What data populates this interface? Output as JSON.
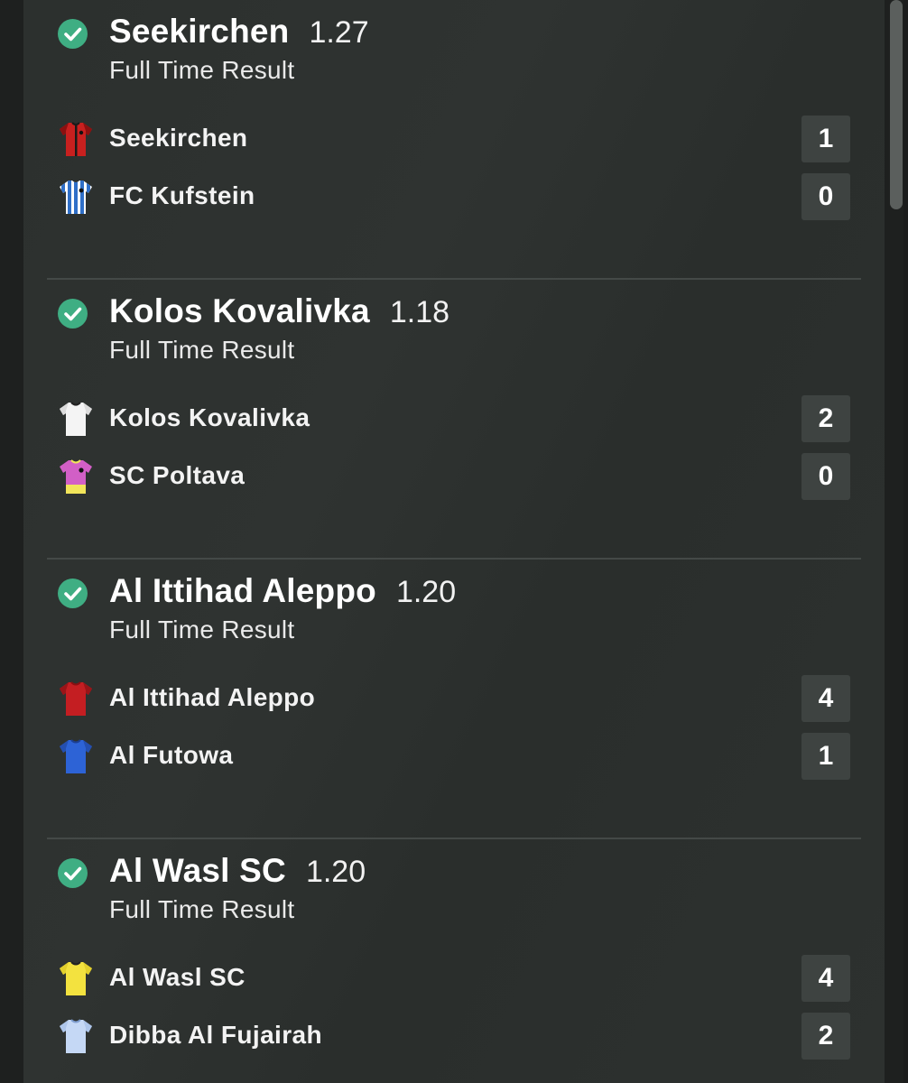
{
  "bets": [
    {
      "status_icon": "check-circle-icon",
      "selection": "Seekirchen",
      "odds": "1.27",
      "market": "Full Time Result",
      "home": {
        "name": "Seekirchen",
        "score": "1",
        "kit": "red-black-jersey"
      },
      "away": {
        "name": "FC Kufstein",
        "score": "0",
        "kit": "blue-white-striped-jersey"
      }
    },
    {
      "status_icon": "check-circle-icon",
      "selection": "Kolos Kovalivka",
      "odds": "1.18",
      "market": "Full Time Result",
      "home": {
        "name": "Kolos Kovalivka",
        "score": "2",
        "kit": "white-jersey"
      },
      "away": {
        "name": "SC Poltava",
        "score": "0",
        "kit": "pink-yellow-jersey"
      }
    },
    {
      "status_icon": "check-circle-icon",
      "selection": "Al Ittihad Aleppo",
      "odds": "1.20",
      "market": "Full Time Result",
      "home": {
        "name": "Al Ittihad Aleppo",
        "score": "4",
        "kit": "red-jersey"
      },
      "away": {
        "name": "Al Futowa",
        "score": "1",
        "kit": "blue-jersey"
      }
    },
    {
      "status_icon": "check-circle-icon",
      "selection": "Al Wasl SC",
      "odds": "1.20",
      "market": "Full Time Result",
      "home": {
        "name": "Al Wasl SC",
        "score": "4",
        "kit": "yellow-jersey"
      },
      "away": {
        "name": "Dibba Al Fujairah",
        "score": "2",
        "kit": "light-blue-jersey"
      }
    }
  ],
  "colors": {
    "win_check": "#3fae83",
    "score_box": "#3e4341"
  }
}
